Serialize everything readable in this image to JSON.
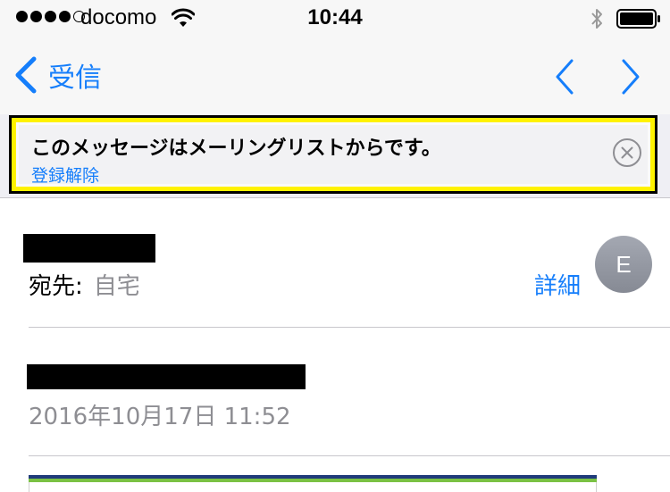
{
  "status_bar": {
    "carrier": "docomo",
    "time": "10:44",
    "signal_bars": 4,
    "signal_max": 5,
    "wifi_icon": "wifi-icon",
    "bluetooth_icon": "bluetooth-icon",
    "battery_icon": "battery-icon"
  },
  "nav": {
    "back_label": "受信",
    "back_icon": "chevron-left-icon",
    "prev_icon": "chevron-left-icon",
    "next_icon": "chevron-right-icon"
  },
  "banner": {
    "message": "このメッセージはメーリングリストからです。",
    "unsubscribe": "登録解除",
    "close_icon": "close-circle-icon"
  },
  "email": {
    "sender": "",
    "to_label": "宛先:",
    "to_value": "自宅",
    "details": "詳細",
    "avatar_initial": "E",
    "subject": "",
    "date": "2016年10月17日 11:52"
  },
  "colors": {
    "accent": "#157efb",
    "secondary_text": "#8e8e93",
    "highlight_yellow": "#fff200",
    "strip_blue": "#1f3b7a",
    "strip_green": "#7ac143"
  }
}
